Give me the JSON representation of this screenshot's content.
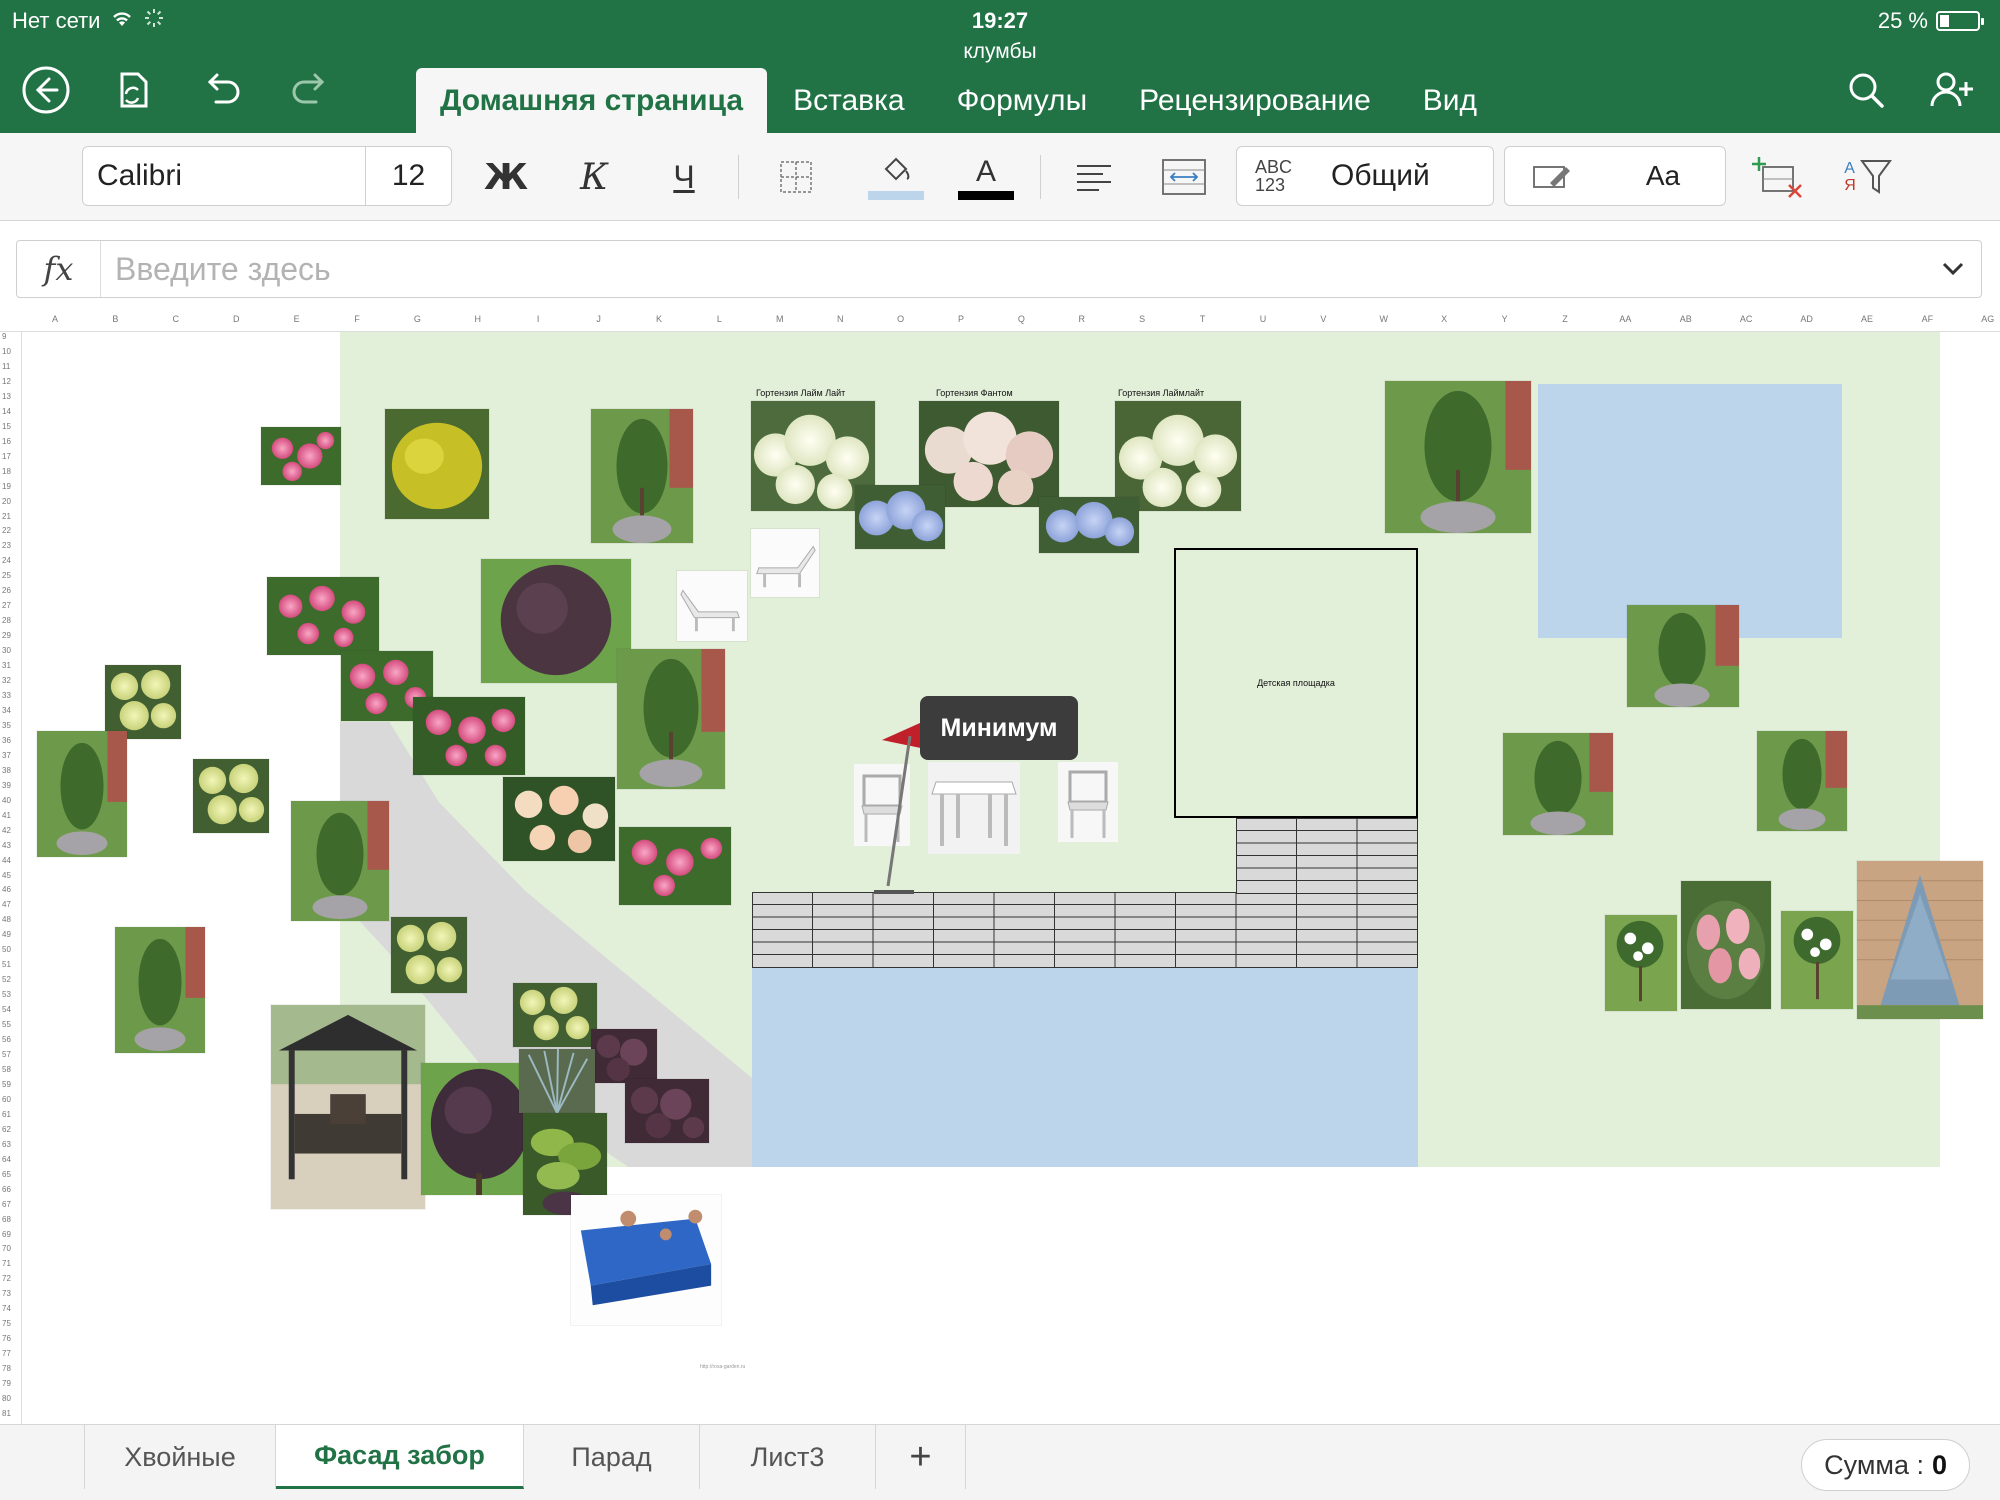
{
  "status": {
    "network": "Нет сети",
    "time": "19:27",
    "battery": "25 %"
  },
  "document": {
    "title": "клумбы"
  },
  "ribbon_tabs": [
    {
      "label": "Домашняя страница",
      "active": true
    },
    {
      "label": "Вставка",
      "active": false
    },
    {
      "label": "Формулы",
      "active": false
    },
    {
      "label": "Рецензирование",
      "active": false
    },
    {
      "label": "Вид",
      "active": false
    }
  ],
  "toolbar": {
    "font_name": "Calibri",
    "font_size": "12",
    "bold": "Ж",
    "italic": "К",
    "underline": "Ч",
    "font_color_glyph": "A",
    "number_format_icon_top": "ABC",
    "number_format_icon_bottom": "123",
    "number_format": "Общий",
    "styles": "Aa",
    "sort_top": "A",
    "sort_bottom": "Я",
    "fill_color": "#bcd5ea",
    "font_color": "#000000"
  },
  "formula_bar": {
    "fx": "fx",
    "placeholder": "Введите здесь",
    "value": ""
  },
  "columns": [
    "A",
    "B",
    "C",
    "D",
    "E",
    "F",
    "G",
    "H",
    "I",
    "J",
    "K",
    "L",
    "M",
    "N",
    "O",
    "P",
    "Q",
    "R",
    "S",
    "T",
    "U",
    "V",
    "W",
    "X",
    "Y",
    "Z",
    "AA",
    "AB",
    "AC",
    "AD",
    "AE",
    "AF",
    "AG"
  ],
  "rows_first": 9,
  "rows_last": 81,
  "canvas": {
    "captions": {
      "hydrangea_1": "Гортензия Лайм Лайт",
      "hydrangea_2": "Гортензия Фантом",
      "hydrangea_3": "Гортензия Лаймлайт",
      "playground": "Детская площадка",
      "watermark": "http://rosa-garden.ru"
    },
    "tooltip": "Минимум",
    "colors": {
      "lawn": "#e2efd9",
      "water": "#bcd5ea",
      "path": "#d9d9d9",
      "playground_border": "#000000"
    }
  },
  "sheet_tabs": [
    {
      "label": "Хвойные",
      "active": false
    },
    {
      "label": "Фасад забор",
      "active": true
    },
    {
      "label": "Парад",
      "active": false
    },
    {
      "label": "Лист3",
      "active": false
    }
  ],
  "add_sheet": "+",
  "sum": {
    "label": "Сумма :",
    "value": "0"
  }
}
